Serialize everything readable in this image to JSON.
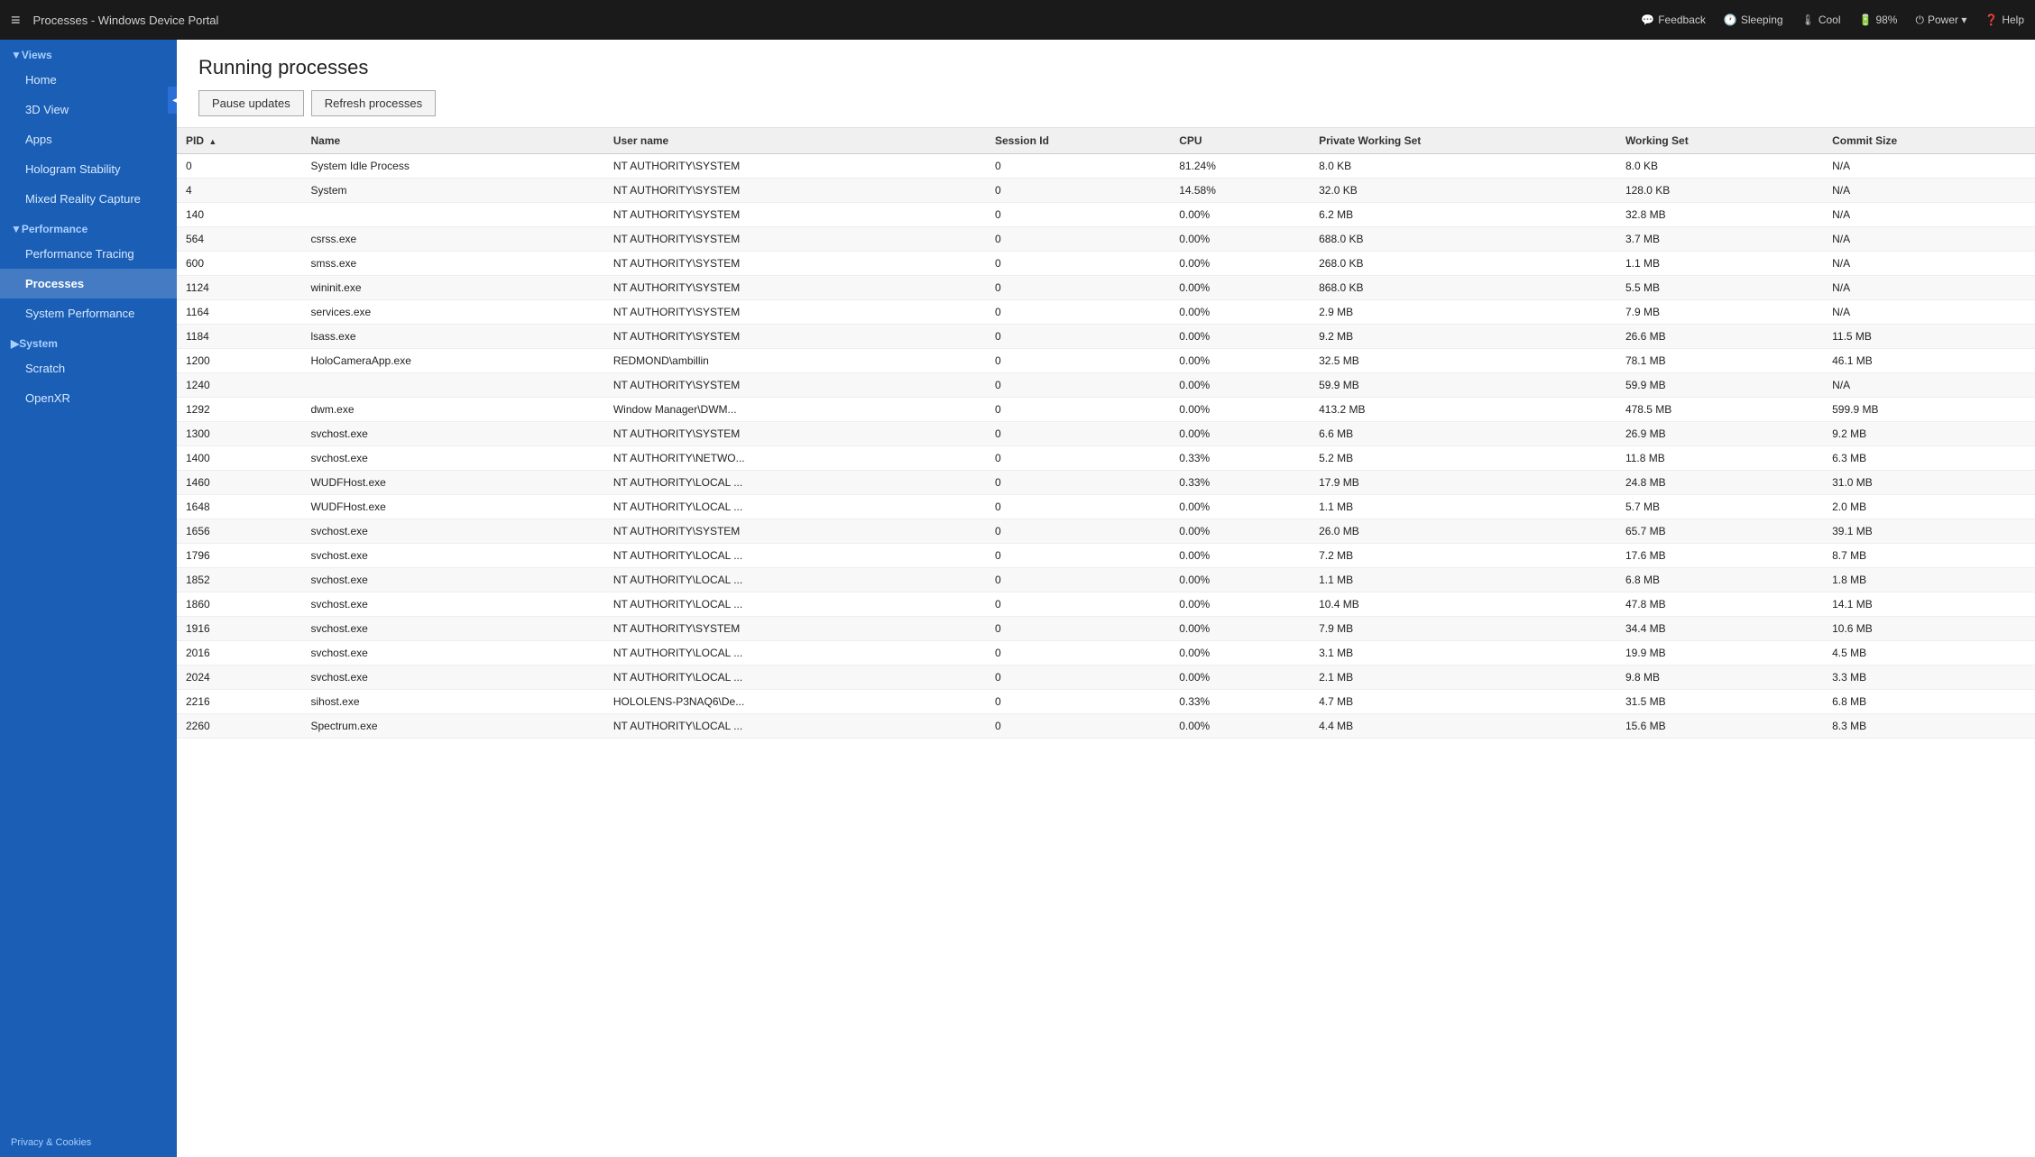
{
  "topbar": {
    "hamburger": "≡",
    "title": "Processes - Windows Device Portal",
    "actions": [
      {
        "id": "feedback",
        "icon": "💬",
        "label": "Feedback"
      },
      {
        "id": "sleeping",
        "icon": "🕐",
        "label": "Sleeping"
      },
      {
        "id": "cool",
        "icon": "🌡",
        "label": "Cool"
      },
      {
        "id": "battery",
        "icon": "🔋",
        "label": "98%"
      },
      {
        "id": "power",
        "icon": "⏻",
        "label": "Power ▾"
      },
      {
        "id": "help",
        "icon": "?",
        "label": "Help"
      }
    ]
  },
  "sidebar": {
    "collapse_arrow": "◀",
    "sections": [
      {
        "label": "▼Views",
        "items": [
          {
            "id": "home",
            "label": "Home",
            "active": false
          },
          {
            "id": "3d-view",
            "label": "3D View",
            "active": false
          },
          {
            "id": "apps",
            "label": "Apps",
            "active": false
          },
          {
            "id": "hologram-stability",
            "label": "Hologram Stability",
            "active": false
          },
          {
            "id": "mixed-reality-capture",
            "label": "Mixed Reality Capture",
            "active": false
          }
        ]
      },
      {
        "label": "▼Performance",
        "items": [
          {
            "id": "performance-tracing",
            "label": "Performance Tracing",
            "active": false
          },
          {
            "id": "processes",
            "label": "Processes",
            "active": true
          },
          {
            "id": "system-performance",
            "label": "System Performance",
            "active": false
          }
        ]
      },
      {
        "label": "▶System",
        "items": []
      },
      {
        "label": "",
        "items": [
          {
            "id": "scratch",
            "label": "Scratch",
            "active": false
          },
          {
            "id": "openxr",
            "label": "OpenXR",
            "active": false
          }
        ]
      }
    ],
    "footer": "Privacy & Cookies"
  },
  "content": {
    "title": "Running processes",
    "buttons": [
      {
        "id": "pause-updates",
        "label": "Pause updates"
      },
      {
        "id": "refresh-processes",
        "label": "Refresh processes"
      }
    ],
    "table": {
      "columns": [
        {
          "id": "pid",
          "label": "PID",
          "sort": true
        },
        {
          "id": "name",
          "label": "Name"
        },
        {
          "id": "user-name",
          "label": "User name"
        },
        {
          "id": "session-id",
          "label": "Session Id"
        },
        {
          "id": "cpu",
          "label": "CPU"
        },
        {
          "id": "private-working-set",
          "label": "Private Working Set"
        },
        {
          "id": "working-set",
          "label": "Working Set"
        },
        {
          "id": "commit-size",
          "label": "Commit Size"
        }
      ],
      "rows": [
        {
          "pid": "0",
          "name": "System Idle Process",
          "user": "NT AUTHORITY\\SYSTEM",
          "session": "0",
          "cpu": "81.24%",
          "private_ws": "8.0 KB",
          "working_set": "8.0 KB",
          "commit": "N/A"
        },
        {
          "pid": "4",
          "name": "System",
          "user": "NT AUTHORITY\\SYSTEM",
          "session": "0",
          "cpu": "14.58%",
          "private_ws": "32.0 KB",
          "working_set": "128.0 KB",
          "commit": "N/A"
        },
        {
          "pid": "140",
          "name": "",
          "user": "NT AUTHORITY\\SYSTEM",
          "session": "0",
          "cpu": "0.00%",
          "private_ws": "6.2 MB",
          "working_set": "32.8 MB",
          "commit": "N/A"
        },
        {
          "pid": "564",
          "name": "csrss.exe",
          "user": "NT AUTHORITY\\SYSTEM",
          "session": "0",
          "cpu": "0.00%",
          "private_ws": "688.0 KB",
          "working_set": "3.7 MB",
          "commit": "N/A"
        },
        {
          "pid": "600",
          "name": "smss.exe",
          "user": "NT AUTHORITY\\SYSTEM",
          "session": "0",
          "cpu": "0.00%",
          "private_ws": "268.0 KB",
          "working_set": "1.1 MB",
          "commit": "N/A"
        },
        {
          "pid": "1124",
          "name": "wininit.exe",
          "user": "NT AUTHORITY\\SYSTEM",
          "session": "0",
          "cpu": "0.00%",
          "private_ws": "868.0 KB",
          "working_set": "5.5 MB",
          "commit": "N/A"
        },
        {
          "pid": "1164",
          "name": "services.exe",
          "user": "NT AUTHORITY\\SYSTEM",
          "session": "0",
          "cpu": "0.00%",
          "private_ws": "2.9 MB",
          "working_set": "7.9 MB",
          "commit": "N/A"
        },
        {
          "pid": "1184",
          "name": "lsass.exe",
          "user": "NT AUTHORITY\\SYSTEM",
          "session": "0",
          "cpu": "0.00%",
          "private_ws": "9.2 MB",
          "working_set": "26.6 MB",
          "commit": "11.5 MB"
        },
        {
          "pid": "1200",
          "name": "HoloCameraApp.exe",
          "user": "REDMOND\\ambillin",
          "session": "0",
          "cpu": "0.00%",
          "private_ws": "32.5 MB",
          "working_set": "78.1 MB",
          "commit": "46.1 MB"
        },
        {
          "pid": "1240",
          "name": "",
          "user": "NT AUTHORITY\\SYSTEM",
          "session": "0",
          "cpu": "0.00%",
          "private_ws": "59.9 MB",
          "working_set": "59.9 MB",
          "commit": "N/A"
        },
        {
          "pid": "1292",
          "name": "dwm.exe",
          "user": "Window Manager\\DWM...",
          "session": "0",
          "cpu": "0.00%",
          "private_ws": "413.2 MB",
          "working_set": "478.5 MB",
          "commit": "599.9 MB"
        },
        {
          "pid": "1300",
          "name": "svchost.exe",
          "user": "NT AUTHORITY\\SYSTEM",
          "session": "0",
          "cpu": "0.00%",
          "private_ws": "6.6 MB",
          "working_set": "26.9 MB",
          "commit": "9.2 MB"
        },
        {
          "pid": "1400",
          "name": "svchost.exe",
          "user": "NT AUTHORITY\\NETWO...",
          "session": "0",
          "cpu": "0.33%",
          "private_ws": "5.2 MB",
          "working_set": "11.8 MB",
          "commit": "6.3 MB"
        },
        {
          "pid": "1460",
          "name": "WUDFHost.exe",
          "user": "NT AUTHORITY\\LOCAL ...",
          "session": "0",
          "cpu": "0.33%",
          "private_ws": "17.9 MB",
          "working_set": "24.8 MB",
          "commit": "31.0 MB"
        },
        {
          "pid": "1648",
          "name": "WUDFHost.exe",
          "user": "NT AUTHORITY\\LOCAL ...",
          "session": "0",
          "cpu": "0.00%",
          "private_ws": "1.1 MB",
          "working_set": "5.7 MB",
          "commit": "2.0 MB"
        },
        {
          "pid": "1656",
          "name": "svchost.exe",
          "user": "NT AUTHORITY\\SYSTEM",
          "session": "0",
          "cpu": "0.00%",
          "private_ws": "26.0 MB",
          "working_set": "65.7 MB",
          "commit": "39.1 MB"
        },
        {
          "pid": "1796",
          "name": "svchost.exe",
          "user": "NT AUTHORITY\\LOCAL ...",
          "session": "0",
          "cpu": "0.00%",
          "private_ws": "7.2 MB",
          "working_set": "17.6 MB",
          "commit": "8.7 MB"
        },
        {
          "pid": "1852",
          "name": "svchost.exe",
          "user": "NT AUTHORITY\\LOCAL ...",
          "session": "0",
          "cpu": "0.00%",
          "private_ws": "1.1 MB",
          "working_set": "6.8 MB",
          "commit": "1.8 MB"
        },
        {
          "pid": "1860",
          "name": "svchost.exe",
          "user": "NT AUTHORITY\\LOCAL ...",
          "session": "0",
          "cpu": "0.00%",
          "private_ws": "10.4 MB",
          "working_set": "47.8 MB",
          "commit": "14.1 MB"
        },
        {
          "pid": "1916",
          "name": "svchost.exe",
          "user": "NT AUTHORITY\\SYSTEM",
          "session": "0",
          "cpu": "0.00%",
          "private_ws": "7.9 MB",
          "working_set": "34.4 MB",
          "commit": "10.6 MB"
        },
        {
          "pid": "2016",
          "name": "svchost.exe",
          "user": "NT AUTHORITY\\LOCAL ...",
          "session": "0",
          "cpu": "0.00%",
          "private_ws": "3.1 MB",
          "working_set": "19.9 MB",
          "commit": "4.5 MB"
        },
        {
          "pid": "2024",
          "name": "svchost.exe",
          "user": "NT AUTHORITY\\LOCAL ...",
          "session": "0",
          "cpu": "0.00%",
          "private_ws": "2.1 MB",
          "working_set": "9.8 MB",
          "commit": "3.3 MB"
        },
        {
          "pid": "2216",
          "name": "sihost.exe",
          "user": "HOLOLENS-P3NAQ6\\De...",
          "session": "0",
          "cpu": "0.33%",
          "private_ws": "4.7 MB",
          "working_set": "31.5 MB",
          "commit": "6.8 MB"
        },
        {
          "pid": "2260",
          "name": "Spectrum.exe",
          "user": "NT AUTHORITY\\LOCAL ...",
          "session": "0",
          "cpu": "0.00%",
          "private_ws": "4.4 MB",
          "working_set": "15.6 MB",
          "commit": "8.3 MB"
        }
      ]
    }
  }
}
